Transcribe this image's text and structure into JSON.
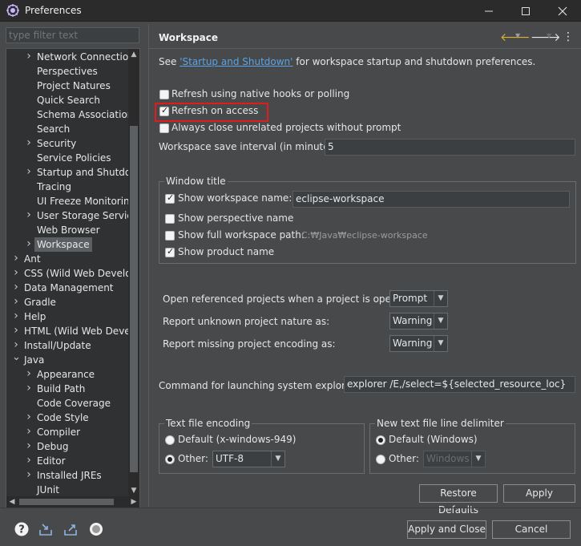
{
  "window": {
    "title": "Preferences"
  },
  "filter": {
    "placeholder": "type filter text"
  },
  "tree": {
    "items": [
      {
        "label": "Network Connection",
        "level": 2,
        "expandable": true
      },
      {
        "label": "Perspectives",
        "level": 2,
        "expandable": false
      },
      {
        "label": "Project Natures",
        "level": 2,
        "expandable": false
      },
      {
        "label": "Quick Search",
        "level": 2,
        "expandable": false
      },
      {
        "label": "Schema Associations",
        "level": 2,
        "expandable": false
      },
      {
        "label": "Search",
        "level": 2,
        "expandable": false
      },
      {
        "label": "Security",
        "level": 2,
        "expandable": true
      },
      {
        "label": "Service Policies",
        "level": 2,
        "expandable": false
      },
      {
        "label": "Startup and Shutdown",
        "level": 2,
        "expandable": true
      },
      {
        "label": "Tracing",
        "level": 2,
        "expandable": false
      },
      {
        "label": "UI Freeze Monitoring",
        "level": 2,
        "expandable": false
      },
      {
        "label": "User Storage Service",
        "level": 2,
        "expandable": true
      },
      {
        "label": "Web Browser",
        "level": 2,
        "expandable": false
      },
      {
        "label": "Workspace",
        "level": 2,
        "expandable": true,
        "selected": true
      },
      {
        "label": "Ant",
        "level": 1,
        "expandable": true
      },
      {
        "label": "CSS (Wild Web Develop",
        "level": 1,
        "expandable": true
      },
      {
        "label": "Data Management",
        "level": 1,
        "expandable": true
      },
      {
        "label": "Gradle",
        "level": 1,
        "expandable": true
      },
      {
        "label": "Help",
        "level": 1,
        "expandable": true
      },
      {
        "label": "HTML (Wild Web Develo",
        "level": 1,
        "expandable": true
      },
      {
        "label": "Install/Update",
        "level": 1,
        "expandable": true
      },
      {
        "label": "Java",
        "level": 1,
        "expandable": true,
        "expanded": true
      },
      {
        "label": "Appearance",
        "level": 2,
        "expandable": true
      },
      {
        "label": "Build Path",
        "level": 2,
        "expandable": true
      },
      {
        "label": "Code Coverage",
        "level": 2,
        "expandable": false
      },
      {
        "label": "Code Style",
        "level": 2,
        "expandable": true
      },
      {
        "label": "Compiler",
        "level": 2,
        "expandable": true
      },
      {
        "label": "Debug",
        "level": 2,
        "expandable": true
      },
      {
        "label": "Editor",
        "level": 2,
        "expandable": true
      },
      {
        "label": "Installed JREs",
        "level": 2,
        "expandable": true
      },
      {
        "label": "JUnit",
        "level": 2,
        "expandable": false
      }
    ]
  },
  "page": {
    "title": "Workspace",
    "see_prefix": "See ",
    "see_link": "'Startup and Shutdown'",
    "see_suffix": " for workspace startup and shutdown preferences.",
    "refresh_native": "Refresh using native hooks or polling",
    "refresh_on_access": "Refresh on access",
    "always_close": "Always close unrelated projects without prompt",
    "save_interval_label": "Workspace save interval (in minutes):",
    "save_interval_value": "5",
    "window_title_group": "Window title",
    "show_workspace_name": "Show workspace name:",
    "workspace_name_value": "eclipse-workspace",
    "show_perspective_name": "Show perspective name",
    "show_full_path": "Show full workspace path:",
    "full_path_value": "C:₩Java₩eclipse-workspace",
    "show_product_name": "Show product name",
    "open_referenced_label": "Open referenced projects when a project is opened:",
    "open_referenced_value": "Prompt",
    "unknown_nature_label": "Report unknown project nature as:",
    "unknown_nature_value": "Warning",
    "missing_encoding_label": "Report missing project encoding as:",
    "missing_encoding_value": "Warning",
    "explorer_label": "Command for launching system explorer:",
    "explorer_value": "explorer /E,/select=${selected_resource_loc}",
    "text_encoding_group": "Text file encoding",
    "encoding_default": "Default (x-windows-949)",
    "encoding_other": "Other:",
    "encoding_other_value": "UTF-8",
    "line_delim_group": "New text file line delimiter",
    "delim_default": "Default (Windows)",
    "delim_other": "Other:",
    "delim_other_value": "Windows",
    "restore_defaults": "Restore Defaults",
    "apply": "Apply"
  },
  "footer": {
    "apply_and_close": "Apply and Close",
    "cancel": "Cancel"
  },
  "checks": {
    "refresh_native": false,
    "refresh_on_access": true,
    "always_close": false,
    "show_workspace_name": true,
    "show_perspective_name": false,
    "show_full_path": false,
    "show_product_name": true
  }
}
